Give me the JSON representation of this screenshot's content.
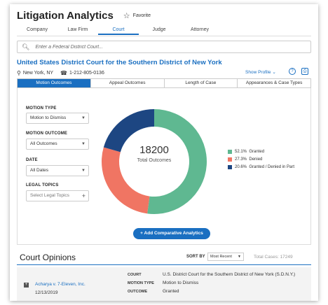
{
  "app": {
    "title": "Litigation Analytics",
    "favorite_label": "Favorite"
  },
  "topnav": [
    "Company",
    "Law Firm",
    "Court",
    "Judge",
    "Attorney"
  ],
  "search": {
    "placeholder": "Enter a Federal District Court..."
  },
  "court": {
    "name": "United States District Court for the Southern District of New York",
    "location": "New York, NY",
    "phone": "1-212-805-0136",
    "show_profile": "Show Profile"
  },
  "subtabs": [
    "Motion Outcomes",
    "Appeal Outcomes",
    "Length of Case",
    "Appearances & Case Types"
  ],
  "filters": {
    "motion_type": {
      "label": "MOTION TYPE",
      "value": "Motion to Dismiss"
    },
    "motion_outcome": {
      "label": "MOTION OUTCOME",
      "value": "All Outcomes"
    },
    "date": {
      "label": "DATE",
      "value": "All Dates"
    },
    "legal_topics": {
      "label": "LEGAL TOPICS",
      "placeholder": "Select Legal Topics"
    }
  },
  "summary": {
    "total": "18200",
    "total_label": "Total Outcomes"
  },
  "chart_data": {
    "type": "pie",
    "title": "",
    "categories": [
      "Granted",
      "Denied",
      "Granted / Denied in Part"
    ],
    "values": [
      52.1,
      27.3,
      20.6
    ],
    "labels": [
      "52.1%",
      "27.3%",
      "20.6%"
    ],
    "colors": [
      "#5fb891",
      "#f07563",
      "#1d4682"
    ],
    "legend_position": "right"
  },
  "add_button": "+ Add Comparative Analytics",
  "opinions": {
    "title": "Court Opinions",
    "sort_label": "SORT BY",
    "sort_value": "Most Recent",
    "total_cases": "Total Cases:  17249",
    "rows": [
      {
        "case": "Acharya v. 7-Eleven, Inc.",
        "date": "12/13/2019",
        "fields": [
          {
            "label": "COURT",
            "value": "U.S. District Court for the Southern District of New York (S.D.N.Y.)"
          },
          {
            "label": "MOTION TYPE",
            "value": "Motion to Dismiss"
          },
          {
            "label": "OUTCOME",
            "value": "Granted"
          }
        ]
      }
    ]
  }
}
